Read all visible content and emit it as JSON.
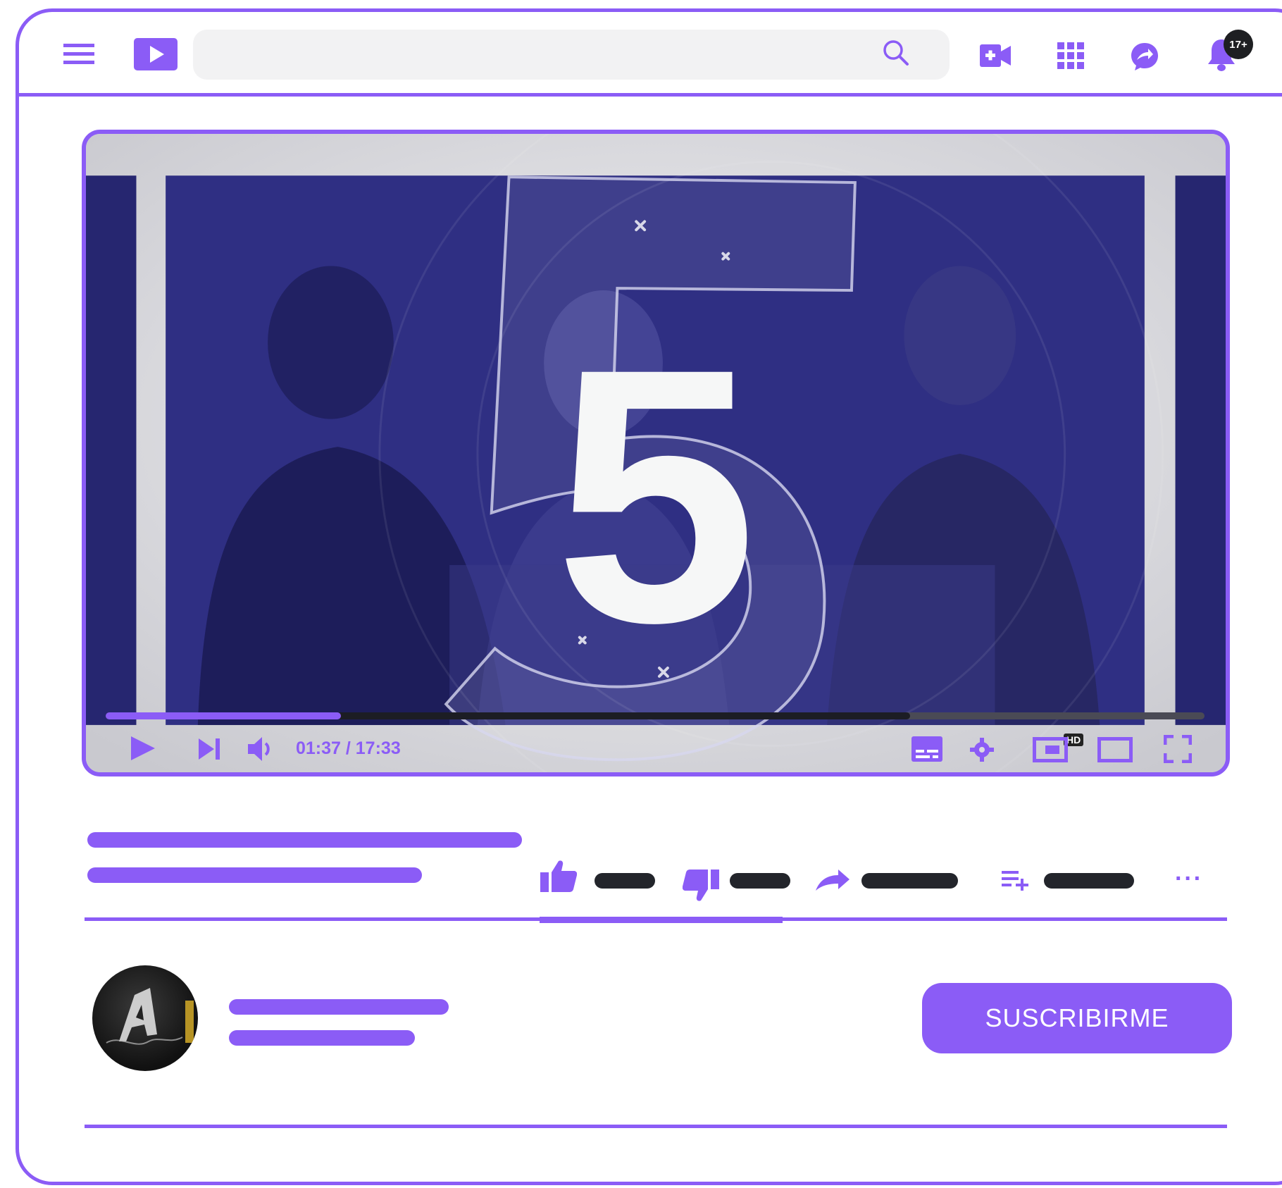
{
  "colors": {
    "accent": "#8b5cf6",
    "dark": "#23252b",
    "search_bg": "#f2f2f3"
  },
  "header": {
    "icons": [
      "menu-icon",
      "logo-play-icon",
      "search-icon",
      "create-video-icon",
      "apps-grid-icon",
      "messages-icon",
      "notifications-bell-icon"
    ],
    "notification_count": "17+"
  },
  "player": {
    "countdown_number": "5",
    "timecode": "01:37 / 17:33",
    "progress_fraction": 0.214,
    "buffer_fraction": 0.732,
    "quality_badge": "HD",
    "controls": [
      "play-icon",
      "next-icon",
      "volume-icon",
      "subtitles-icon",
      "settings-icon",
      "miniplayer-icon",
      "theater-mode-icon",
      "fullscreen-icon"
    ]
  },
  "actions": {
    "icons": [
      "like-icon",
      "dislike-icon",
      "share-icon",
      "save-to-playlist-icon",
      "more-options-icon"
    ],
    "more_label": "···"
  },
  "channel": {
    "subscribe_label": "SUSCRIBIRME"
  }
}
